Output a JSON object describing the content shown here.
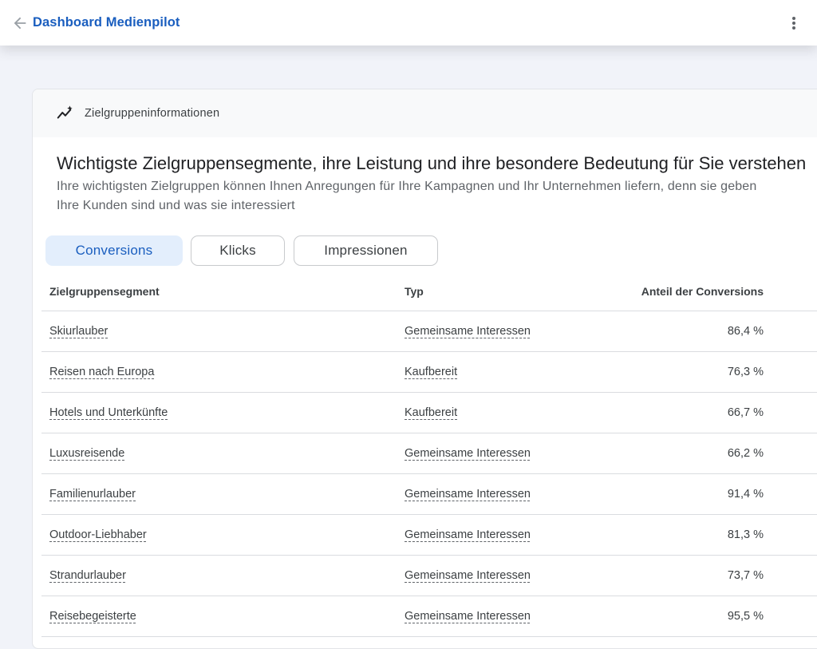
{
  "header": {
    "title": "Dashboard Medienpilot"
  },
  "card": {
    "label": "Zielgruppeninformationen",
    "headline": "Wichtigste Zielgruppensegmente, ihre Leistung und ihre besondere Bedeutung für Sie verstehen",
    "description_line1": "Ihre wichtigsten Zielgruppen können Ihnen Anregungen für Ihre Kampagnen und Ihr Unternehmen liefern, denn sie geben",
    "description_line2": "Ihre Kunden sind und was sie interessiert"
  },
  "tabs": [
    {
      "label": "Conversions",
      "active": true
    },
    {
      "label": "Klicks",
      "active": false
    },
    {
      "label": "Impressionen",
      "active": false
    }
  ],
  "table": {
    "columns": [
      "Zielgruppensegment",
      "Typ",
      "Anteil der Conversions"
    ],
    "rows": [
      {
        "segment": "Skiurlauber",
        "type": "Gemeinsame Interessen",
        "share": "86,4 %"
      },
      {
        "segment": "Reisen nach Europa",
        "type": "Kaufbereit",
        "share": "76,3 %"
      },
      {
        "segment": "Hotels und Unterkünfte",
        "type": "Kaufbereit",
        "share": "66,7 %"
      },
      {
        "segment": "Luxusreisende",
        "type": "Gemeinsame Interessen",
        "share": "66,2 %"
      },
      {
        "segment": "Familienurlauber",
        "type": "Gemeinsame Interessen",
        "share": "91,4 %"
      },
      {
        "segment": "Outdoor-Liebhaber",
        "type": "Gemeinsame Interessen",
        "share": "81,3 %"
      },
      {
        "segment": "Strandurlauber",
        "type": "Gemeinsame Interessen",
        "share": "73,7 %"
      },
      {
        "segment": "Reisebegeisterte",
        "type": "Gemeinsame Interessen",
        "share": "95,5 %"
      }
    ]
  },
  "colors": {
    "accent": "#1a5ebf",
    "active_chip_bg": "#e3eefc",
    "page_bg": "#f1f3f9"
  },
  "icons": {
    "back": "arrow-back-icon",
    "more": "more-vert-icon",
    "insights": "insights-icon"
  }
}
